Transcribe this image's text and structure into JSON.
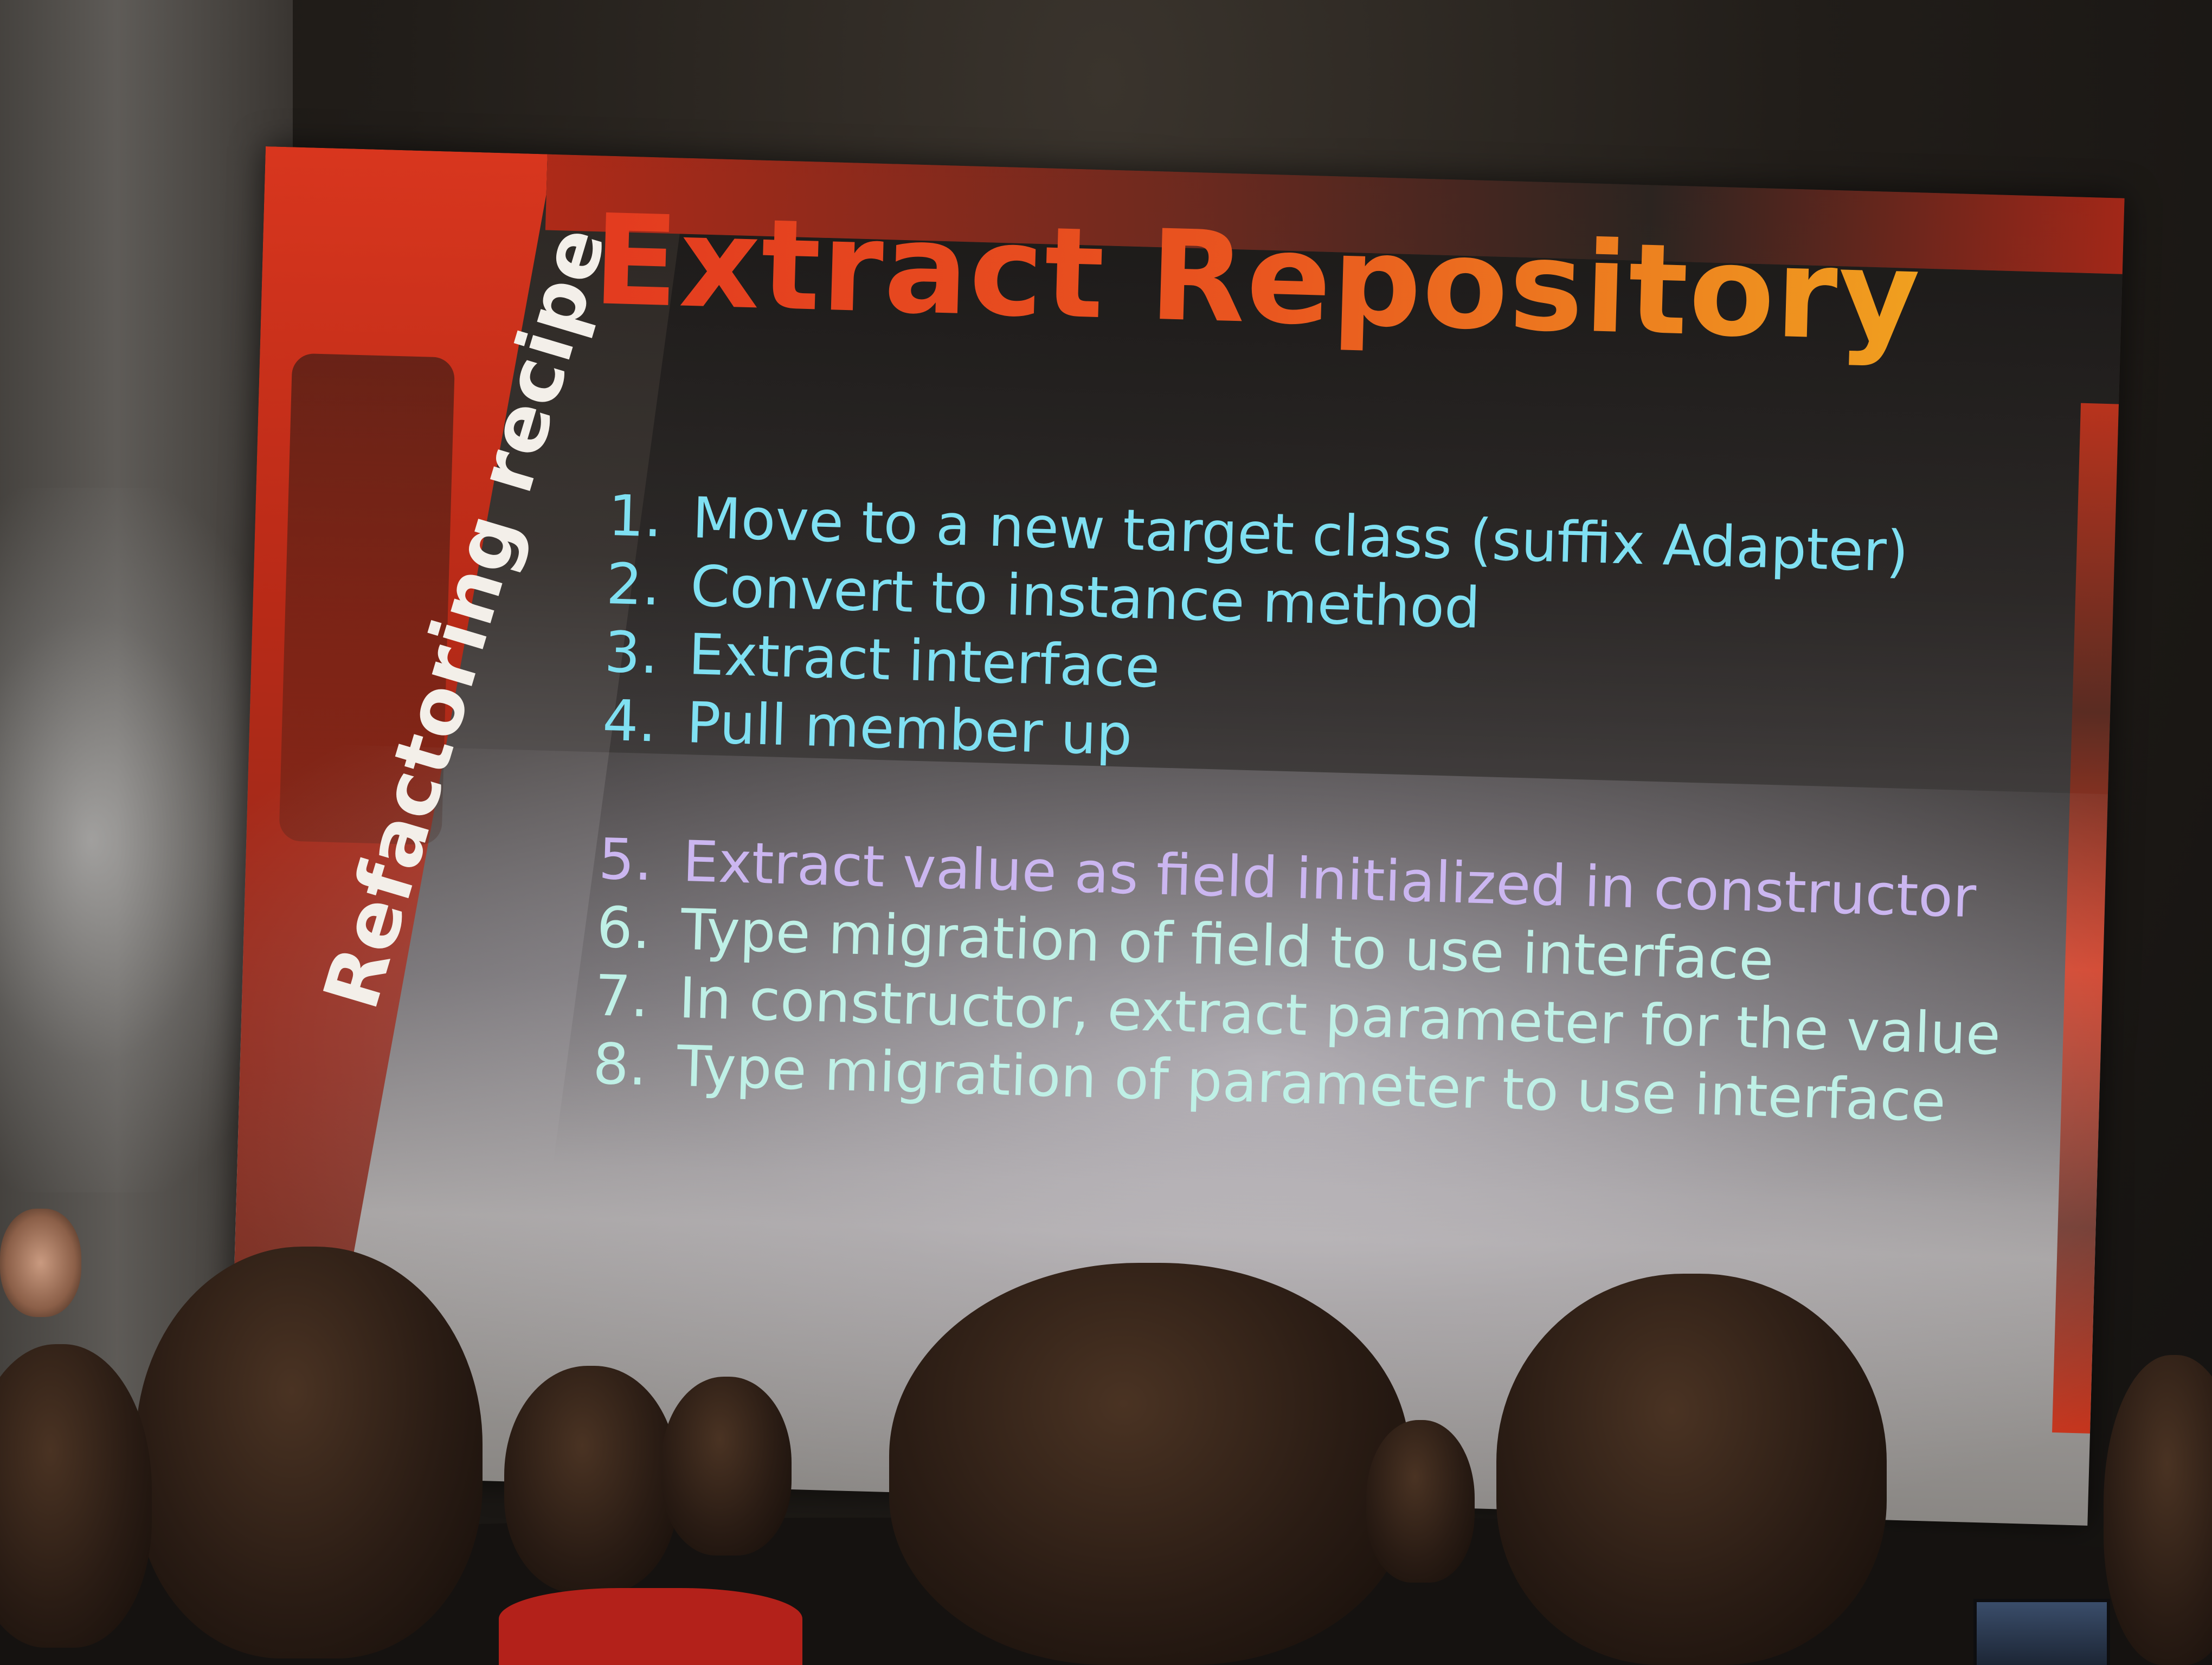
{
  "slide": {
    "side_label": "Refactoring recipe",
    "title": "Extract Repository",
    "steps_group_a": [
      {
        "number": "1.",
        "text": "Move to a new target class (suffix Adapter)"
      },
      {
        "number": "2.",
        "text": "Convert to instance method"
      },
      {
        "number": "3.",
        "text": "Extract interface"
      },
      {
        "number": "4.",
        "text": "Pull member up"
      }
    ],
    "steps_group_b": [
      {
        "number": "5.",
        "text": "Extract value as field initialized in constructor"
      },
      {
        "number": "6.",
        "text": "Type migration of field to use interface"
      },
      {
        "number": "7.",
        "text": "In constructor, extract parameter for the value"
      },
      {
        "number": "8.",
        "text": "Type migration of parameter to use interface"
      }
    ]
  },
  "colors": {
    "title_start": "#e33b1f",
    "title_end": "#f0a01f",
    "steps_a": "#7fe0f2",
    "steps_b": "#bff0e6",
    "band_red": "#d8361e"
  }
}
